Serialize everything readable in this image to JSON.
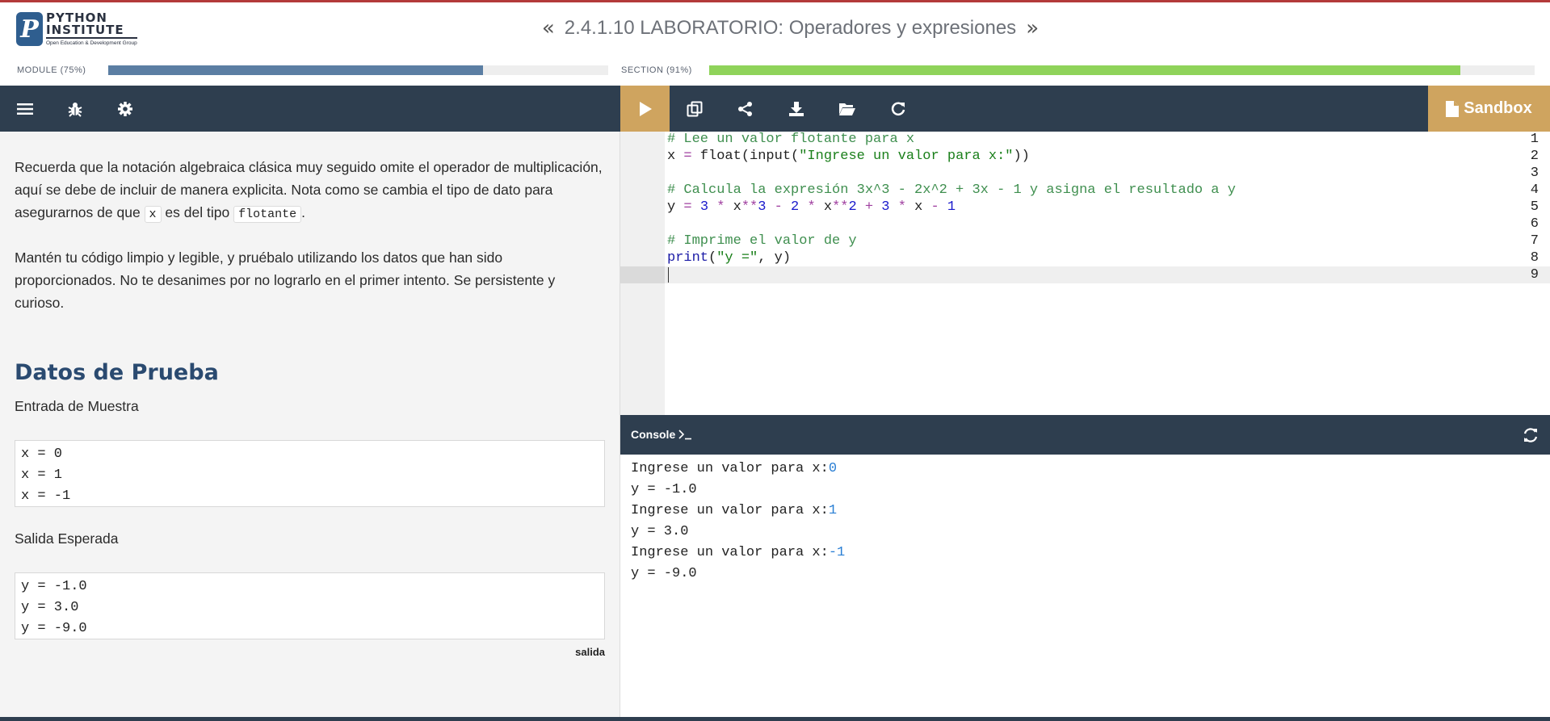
{
  "header": {
    "logo": {
      "line1": "PYTHON",
      "line2": "INSTITUTE",
      "tagline": "Open Education & Development Group",
      "mark": "P"
    },
    "prev_icon": "double-chevron-left",
    "next_icon": "double-chevron-right",
    "title": "2.4.1.10 LABORATORIO: Operadores y expresiones"
  },
  "progress": {
    "module": {
      "label": "MODULE (75%)",
      "value": 0.75,
      "color": "#5b7ea3"
    },
    "section": {
      "label": "SECTION (91%)",
      "value": 0.91,
      "color": "#8fd35a"
    }
  },
  "toolbar": {
    "left_icons": [
      "menu-icon",
      "bug-icon",
      "gear-icon"
    ],
    "right_icons": [
      "play-icon",
      "copy-icon",
      "share-icon",
      "download-icon",
      "folder-open-icon",
      "refresh-icon"
    ],
    "sandbox_label": "Sandbox"
  },
  "instructions": {
    "para1_a": "Recuerda que la notación algebraica clásica muy seguido omite el operador de multiplicación, aquí se debe de incluir de manera explicita. Nota como se cambia el tipo de dato para asegurarnos de que ",
    "para1_code1": "x",
    "para1_b": " es del tipo ",
    "para1_code2": "flotante",
    "para1_c": ".",
    "para2": "Mantén tu código limpio y legible, y pruébalo utilizando los datos que han sido proporcionados. No te desanimes por no lograrlo en el primer intento. Se persistente y curioso.",
    "heading": "Datos de Prueba",
    "sample_input_label": "Entrada de Muestra",
    "sample_input": [
      "x = 0",
      "x = 1",
      "x = -1"
    ],
    "expected_output_label": "Salida Esperada",
    "expected_output": [
      "y = -1.0",
      "y = 3.0",
      "y = -9.0"
    ],
    "output_tag": "salida"
  },
  "editor": {
    "line_numbers": [
      "1",
      "2",
      "3",
      "4",
      "5",
      "6",
      "7",
      "8",
      "9"
    ],
    "lines": [
      "# Lee un valor flotante para x",
      "x = float(input(\"Ingrese un valor para x:\"))",
      "",
      "# Calcula la expresión 3x^3 - 2x^2 + 3x - 1 y asigna el resultado a y",
      "y = 3 * x**3 - 2 * x**2 + 3 * x - 1",
      "",
      "# Imprime el valor de y",
      "print(\"y =\", y)",
      ""
    ]
  },
  "console": {
    "title": "Console",
    "prompt_icon": "terminal-prompt-icon",
    "refresh_icon": "refresh-icon",
    "prompt_text": "Ingrese un valor para x:",
    "entries": [
      {
        "input": "0",
        "output": "y = -1.0"
      },
      {
        "input": "1",
        "output": "y = 3.0"
      },
      {
        "input": "-1",
        "output": "y = -9.0"
      }
    ]
  }
}
